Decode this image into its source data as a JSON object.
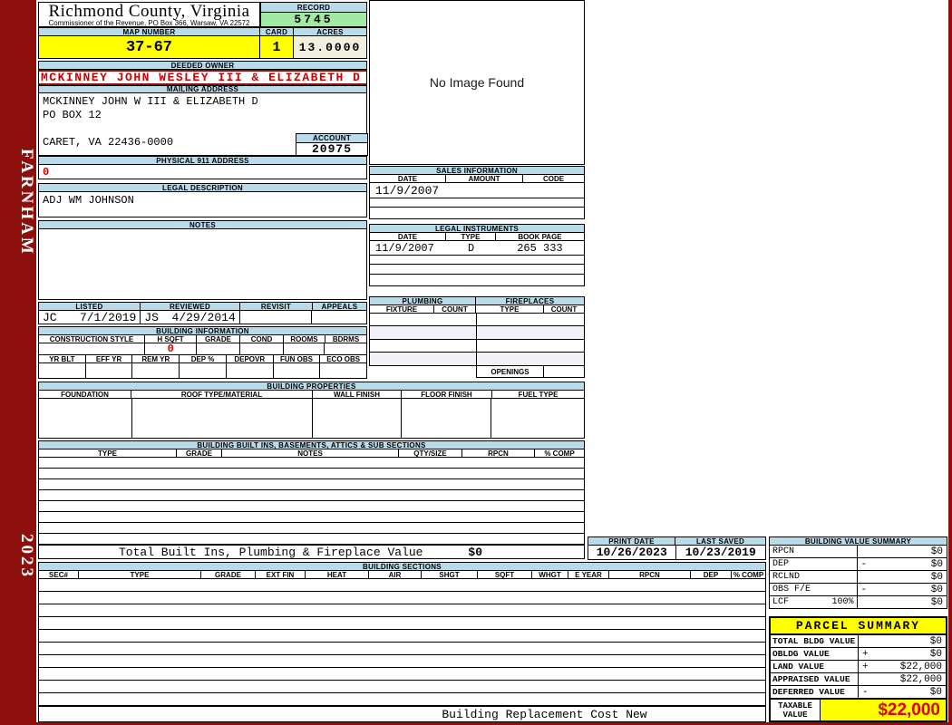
{
  "sidebar": {
    "district": "FARNHAM",
    "year": "2023"
  },
  "header": {
    "county_title": "Richmond County, Virginia",
    "county_subtitle": "Commissioner of the Revenue, PO Box 366, Warsaw, VA 22572",
    "record_label": "RECORD",
    "record_number": "5745",
    "map_number_label": "MAP NUMBER",
    "map_number": "37-67",
    "card_label": "CARD",
    "card_number": "1",
    "acres_label": "ACRES",
    "acres": "13.0000"
  },
  "owner": {
    "deeded_owner_label": "DEEDED OWNER",
    "deeded_owner": "MCKINNEY JOHN WESLEY III & ELIZABETH D",
    "mailing_address_label": "MAILING ADDRESS",
    "mailing_line1": "MCKINNEY JOHN W III & ELIZABETH D",
    "mailing_line2": "PO BOX 12",
    "mailing_line3": "",
    "mailing_line4": "CARET, VA 22436-0000",
    "account_label": "ACCOUNT",
    "account_number": "20975",
    "physical_911_label": "PHYSICAL 911 ADDRESS",
    "physical_911_value": "0",
    "legal_description_label": "LEGAL DESCRIPTION",
    "legal_description": "ADJ WM JOHNSON",
    "notes_label": "NOTES",
    "notes": ""
  },
  "review": {
    "listed_label": "LISTED",
    "reviewed_label": "REVIEWED",
    "revisit_label": "REVISIT",
    "appeals_label": "APPEALS",
    "listed_by": "JC",
    "listed_date": "7/1/2019",
    "reviewed_by": "JS",
    "reviewed_date": "4/29/2014",
    "revisit_value": "",
    "appeals_value": ""
  },
  "building_information": {
    "title": "BUILDING INFORMATION",
    "row1_headers": [
      "CONSTRUCTION STYLE",
      "H SQFT",
      "GRADE",
      "COND",
      "ROOMS",
      "BDRMS"
    ],
    "h_sqft_value": "0",
    "row2_headers": [
      "YR BLT",
      "EFF YR",
      "REM YR",
      "DEP %",
      "DEPOVR",
      "FUN OBS",
      "ECO OBS"
    ]
  },
  "building_properties": {
    "title": "BUILDING PROPERTIES",
    "headers": [
      "FOUNDATION",
      "ROOF TYPE/MATERIAL",
      "WALL FINISH",
      "FLOOR FINISH",
      "FUEL TYPE"
    ]
  },
  "built_ins": {
    "title": "BUILDING BUILT INS, BASEMENTS, ATTICS & SUB SECTIONS",
    "headers": [
      "TYPE",
      "GRADE",
      "NOTES",
      "QTY/SIZE",
      "RPCN",
      "% COMP"
    ],
    "total_label": "Total Built Ins, Plumbing & Fireplace Value",
    "total_value": "$0"
  },
  "image_panel": {
    "no_image_text": "No Image Found"
  },
  "sales_information": {
    "title": "SALES INFORMATION",
    "headers": [
      "DATE",
      "AMOUNT",
      "CODE"
    ],
    "rows": [
      {
        "date": "11/9/2007",
        "amount": "",
        "code": ""
      }
    ]
  },
  "legal_instruments": {
    "title": "LEGAL INSTRUMENTS",
    "headers": [
      "DATE",
      "TYPE",
      "BOOK PAGE"
    ],
    "rows": [
      {
        "date": "11/9/2007",
        "type": "D",
        "book_page": "265 333"
      }
    ]
  },
  "plumbing": {
    "title": "PLUMBING",
    "headers": [
      "FIXTURE",
      "COUNT"
    ]
  },
  "fireplaces": {
    "title": "FIREPLACES",
    "headers": [
      "TYPE",
      "COUNT"
    ],
    "openings_label": "OPENINGS"
  },
  "print_info": {
    "print_date_label": "PRINT DATE",
    "print_date": "10/26/2023",
    "last_saved_label": "LAST SAVED",
    "last_saved": "10/23/2019"
  },
  "building_value_summary": {
    "title": "BUILDING VALUE SUMMARY",
    "rows": [
      {
        "label": "RPCN",
        "extra": "",
        "op": "",
        "value": "$0"
      },
      {
        "label": "DEP",
        "extra": "",
        "op": "-",
        "value": "$0"
      },
      {
        "label": "RCLND",
        "extra": "",
        "op": "",
        "value": "$0"
      },
      {
        "label": "OBS F/E",
        "extra": "",
        "op": "-",
        "value": "$0"
      },
      {
        "label": "LCF",
        "extra": "100%",
        "op": "",
        "value": "$0"
      }
    ]
  },
  "building_sections": {
    "title": "BUILDING SECTIONS",
    "headers": [
      "SEC#",
      "TYPE",
      "GRADE",
      "EXT FIN",
      "HEAT",
      "AIR",
      "SHGT",
      "SQFT",
      "WHGT",
      "E YEAR",
      "RPCN",
      "DEP",
      "% COMP"
    ],
    "footer_label": "Building Replacement Cost New"
  },
  "parcel_summary": {
    "title": "PARCEL SUMMARY",
    "rows": [
      {
        "label": "TOTAL BLDG VALUE",
        "op": "",
        "value": "$0"
      },
      {
        "label": "OBLDG VALUE",
        "op": "+",
        "value": "$0"
      },
      {
        "label": "LAND VALUE",
        "op": "+",
        "value": "$22,000"
      },
      {
        "label": "APPRAISED VALUE",
        "op": "",
        "value": "$22,000"
      },
      {
        "label": "DEFERRED VALUE",
        "op": "-",
        "value": "$0"
      }
    ],
    "taxable_label_line1": "TAXABLE",
    "taxable_label_line2": "VALUE",
    "taxable_value": "$22,000"
  },
  "colors": {
    "maroon": "#8C0F0B",
    "band_blue": "#B9DBE9",
    "record_green": "#A3E8A3",
    "highlight_yellow": "#FFFF00",
    "acres_cream": "#F1F0DF",
    "alert_red": "#CC0000"
  }
}
